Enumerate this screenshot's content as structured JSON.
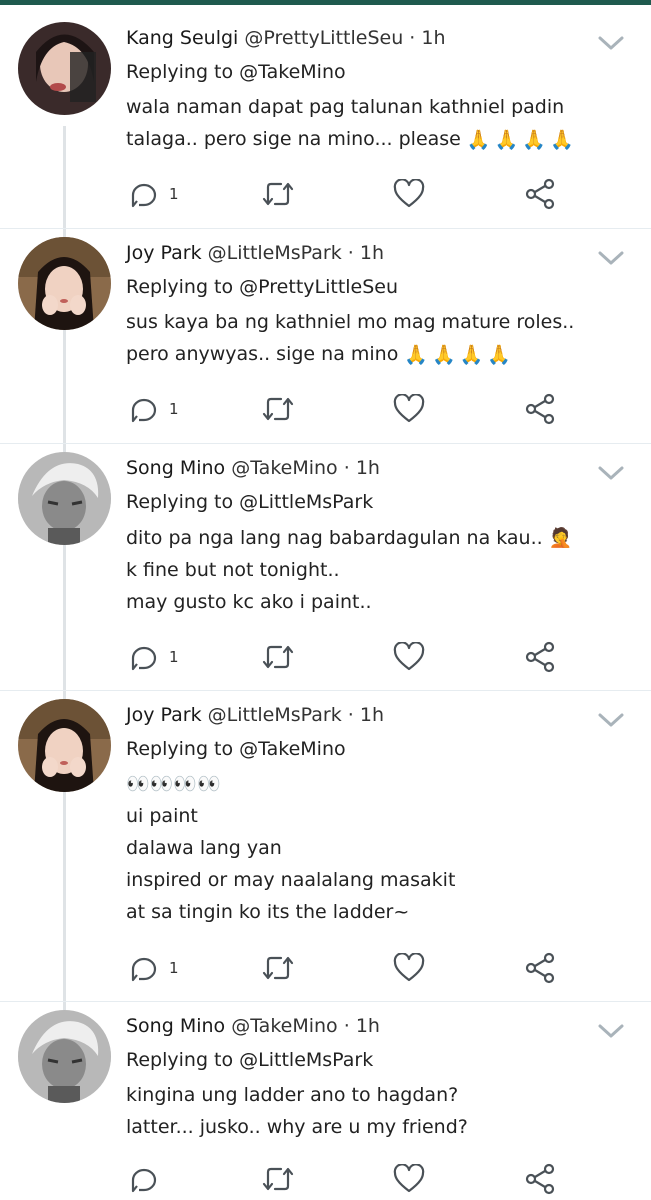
{
  "tweets": [
    {
      "display_name": "Kang Seulgi",
      "handle": "@PrettyLittleSeu",
      "time": "1h",
      "replying_to": "Replying to @TakeMino",
      "lines": [
        "wala naman dapat pag talunan kathniel padin",
        "talaga.. pero sige na mino... please"
      ],
      "emoji": [
        "🙏",
        "🙏",
        "🙏",
        "🙏"
      ],
      "reply_count": "1"
    },
    {
      "display_name": "Joy Park",
      "handle": "@LittleMsPark",
      "time": "1h",
      "replying_to": "Replying to @PrettyLittleSeu",
      "lines": [
        "sus kaya ba ng kathniel mo mag mature roles..",
        "pero anywyas.. sige na mino"
      ],
      "emoji": [
        "🙏",
        "🙏",
        "🙏",
        "🙏"
      ],
      "reply_count": "1"
    },
    {
      "display_name": "Song Mino",
      "handle": "@TakeMino",
      "time": "1h",
      "replying_to": "Replying to @LittleMsPark",
      "lines": [
        "dito pa nga lang nag babardagulan na kau..",
        "k fine but not tonight..",
        "may gusto kc ako i paint.."
      ],
      "emoji": [
        "🤦"
      ],
      "reply_count": "1"
    },
    {
      "display_name": "Joy Park",
      "handle": "@LittleMsPark",
      "time": "1h",
      "replying_to": "Replying to @TakeMino",
      "lines": [
        "👀👀👀👀",
        "ui paint",
        "dalawa lang yan",
        "inspired or may naalalang masakit",
        "at sa tingin ko its the ladder~"
      ],
      "emoji": [],
      "reply_count": "1"
    },
    {
      "display_name": "Song Mino",
      "handle": "@TakeMino",
      "time": "1h",
      "replying_to": "Replying to @LittleMsPark",
      "lines": [
        "kingina ung ladder ano to hagdan?",
        "latter... jusko.. why are u my friend?"
      ],
      "emoji": [],
      "reply_count": ""
    }
  ],
  "separator": "·",
  "icons": {
    "reply": "reply-icon",
    "retweet": "retweet-icon",
    "like": "heart-icon",
    "share": "share-icon",
    "more": "chevron-down-icon"
  },
  "colors": {
    "top_bar": "#1f5a4e",
    "icon": "#4a5157",
    "thread_line": "#dfe3e6",
    "chevron": "#a9b3ba"
  }
}
